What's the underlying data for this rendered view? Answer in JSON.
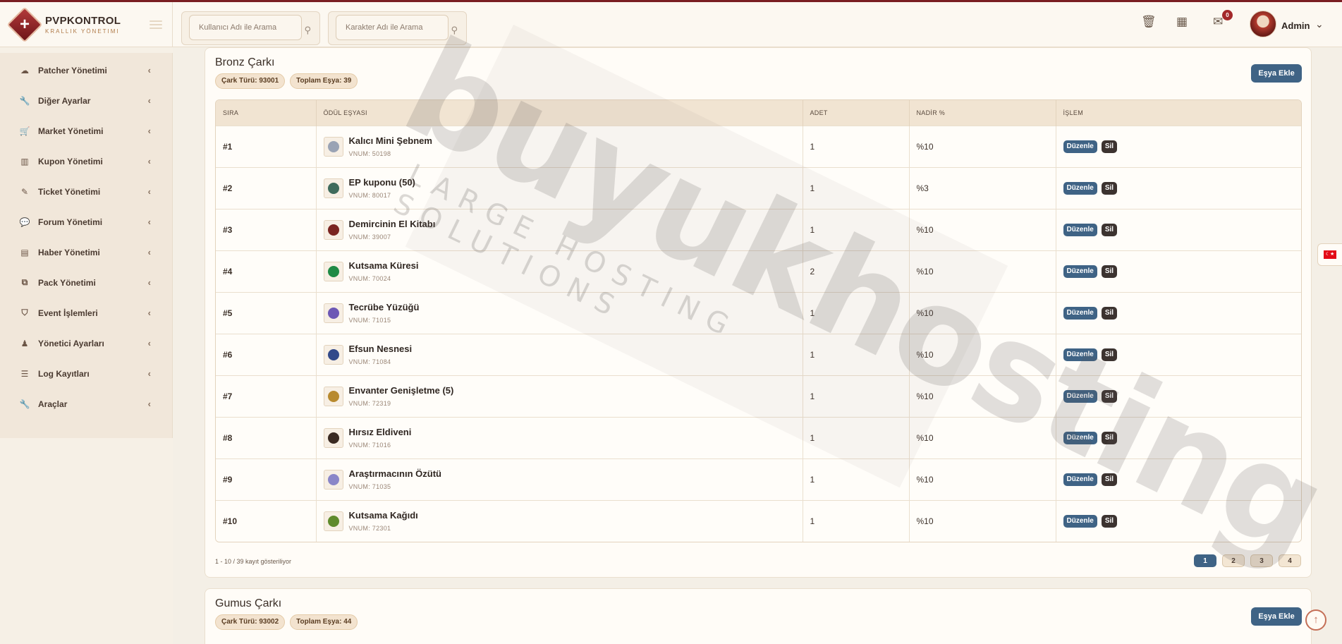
{
  "brand": {
    "name": "PVPKONTROL",
    "subtitle": "KRALLIK YÖNETIMI"
  },
  "sidebar": {
    "items": [
      {
        "label": "Patcher Yönetimi",
        "icon": "cloud-icon",
        "glyph": "☁"
      },
      {
        "label": "Diğer Ayarlar",
        "icon": "wrench-icon",
        "glyph": "🔧"
      },
      {
        "label": "Market Yönetimi",
        "icon": "cart-icon",
        "glyph": "🛒"
      },
      {
        "label": "Kupon Yönetimi",
        "icon": "barcode-icon",
        "glyph": "▥"
      },
      {
        "label": "Ticket Yönetimi",
        "icon": "ticket-icon",
        "glyph": "✎"
      },
      {
        "label": "Forum Yönetimi",
        "icon": "comments-icon",
        "glyph": "💬"
      },
      {
        "label": "Haber Yönetimi",
        "icon": "newspaper-icon",
        "glyph": "▤"
      },
      {
        "label": "Pack Yönetimi",
        "icon": "pack-icon",
        "glyph": "⧉"
      },
      {
        "label": "Event İşlemleri",
        "icon": "shield-icon",
        "glyph": "⛉"
      },
      {
        "label": "Yönetici Ayarları",
        "icon": "user-tie-icon",
        "glyph": "♟"
      },
      {
        "label": "Log Kayıtları",
        "icon": "list-icon",
        "glyph": "☰"
      },
      {
        "label": "Araçlar",
        "icon": "tools-icon",
        "glyph": "🔧"
      }
    ]
  },
  "topbar": {
    "search_user_placeholder": "Kullanıcı Adı ile Arama",
    "search_char_placeholder": "Karakter Adı ile Arama",
    "notification_count": "0",
    "admin_name": "Admin"
  },
  "wheels": [
    {
      "title": "Bronz Çarkı",
      "type_label": "Çark Türü: 93001",
      "total_label": "Toplam Eşya: 39",
      "add_label": "Eşya Ekle",
      "headers": [
        "SIRA",
        "ÖDÜL EŞYASI",
        "ADET",
        "NADİR %",
        "İŞLEM"
      ],
      "rows": [
        {
          "no": "#1",
          "name": "Kalıcı Mini Şebnem",
          "vnum": "VNUM: 50198",
          "qty": "1",
          "rate": "%10",
          "color": "#9aa3b4"
        },
        {
          "no": "#2",
          "name": "EP kuponu (50)",
          "vnum": "VNUM: 80017",
          "qty": "1",
          "rate": "%3",
          "color": "#3f6b5c"
        },
        {
          "no": "#3",
          "name": "Demircinin El Kitabı",
          "vnum": "VNUM: 39007",
          "qty": "1",
          "rate": "%10",
          "color": "#7a2420"
        },
        {
          "no": "#4",
          "name": "Kutsama Küresi",
          "vnum": "VNUM: 70024",
          "qty": "2",
          "rate": "%10",
          "color": "#1f8a45"
        },
        {
          "no": "#5",
          "name": "Tecrübe Yüzüğü",
          "vnum": "VNUM: 71015",
          "qty": "1",
          "rate": "%10",
          "color": "#6d58b5"
        },
        {
          "no": "#6",
          "name": "Efsun Nesnesi",
          "vnum": "VNUM: 71084",
          "qty": "1",
          "rate": "%10",
          "color": "#334a8a"
        },
        {
          "no": "#7",
          "name": "Envanter Genişletme (5)",
          "vnum": "VNUM: 72319",
          "qty": "1",
          "rate": "%10",
          "color": "#b88a2e"
        },
        {
          "no": "#8",
          "name": "Hırsız Eldiveni",
          "vnum": "VNUM: 71016",
          "qty": "1",
          "rate": "%10",
          "color": "#3a2a22"
        },
        {
          "no": "#9",
          "name": "Araştırmacının Özütü",
          "vnum": "VNUM: 71035",
          "qty": "1",
          "rate": "%10",
          "color": "#8a86c8"
        },
        {
          "no": "#10",
          "name": "Kutsama Kağıdı",
          "vnum": "VNUM: 72301",
          "qty": "1",
          "rate": "%10",
          "color": "#5f8a2c"
        }
      ],
      "edit_label": "Düzenle",
      "delete_label": "Sil",
      "pager_info": "1 - 10 / 39 kayıt gösteriliyor",
      "pages": [
        "1",
        "2",
        "3",
        "4"
      ]
    },
    {
      "title": "Gumus Çarkı",
      "type_label": "Çark Türü: 93002",
      "total_label": "Toplam Eşya: 44",
      "add_label": "Eşya Ekle"
    }
  ],
  "watermark": {
    "main": "buyukhosting",
    "sub": "LARGE HOSTING SOLUTIONS"
  },
  "colors": {
    "accent": "#3f6385",
    "brand_red": "#7a1e22",
    "danger_dark": "#3c3330"
  }
}
